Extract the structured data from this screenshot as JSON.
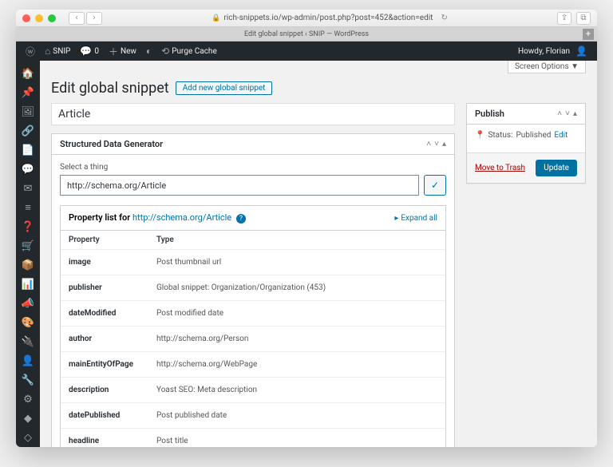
{
  "browser": {
    "url": "rich-snippets.io/wp-admin/post.php?post=452&action=edit",
    "tab_title": "Edit global snippet ‹ SNIP — WordPress"
  },
  "adminbar": {
    "site": "SNIP",
    "comments": "0",
    "new": "New",
    "purge": "Purge Cache",
    "howdy": "Howdy, Florian"
  },
  "screen_options": "Screen Options ▼",
  "heading": "Edit global snippet",
  "add_new": "Add new global snippet",
  "title_value": "Article",
  "sdg": {
    "panel_title": "Structured Data Generator",
    "select_label": "Select a thing",
    "thing_value": "http://schema.org/Article",
    "property_list_prefix": "Property list for ",
    "property_list_link": "http://schema.org/Article",
    "expand_all": "Expand all",
    "col_property": "Property",
    "col_type": "Type",
    "rows": [
      {
        "property": "image",
        "type": "Post thumbnail url"
      },
      {
        "property": "publisher",
        "type": "Global snippet: Organization/Organization (453)"
      },
      {
        "property": "dateModified",
        "type": "Post modified date"
      },
      {
        "property": "author",
        "type": "http://schema.org/Person"
      },
      {
        "property": "mainEntityOfPage",
        "type": "http://schema.org/WebPage"
      },
      {
        "property": "description",
        "type": "Yoast SEO: Meta description"
      },
      {
        "property": "datePublished",
        "type": "Post published date"
      },
      {
        "property": "headline",
        "type": "Post title"
      }
    ]
  },
  "publish": {
    "panel_title": "Publish",
    "status_label": "Status:",
    "status_value": "Published",
    "edit": "Edit",
    "trash": "Move to Trash",
    "update": "Update"
  }
}
